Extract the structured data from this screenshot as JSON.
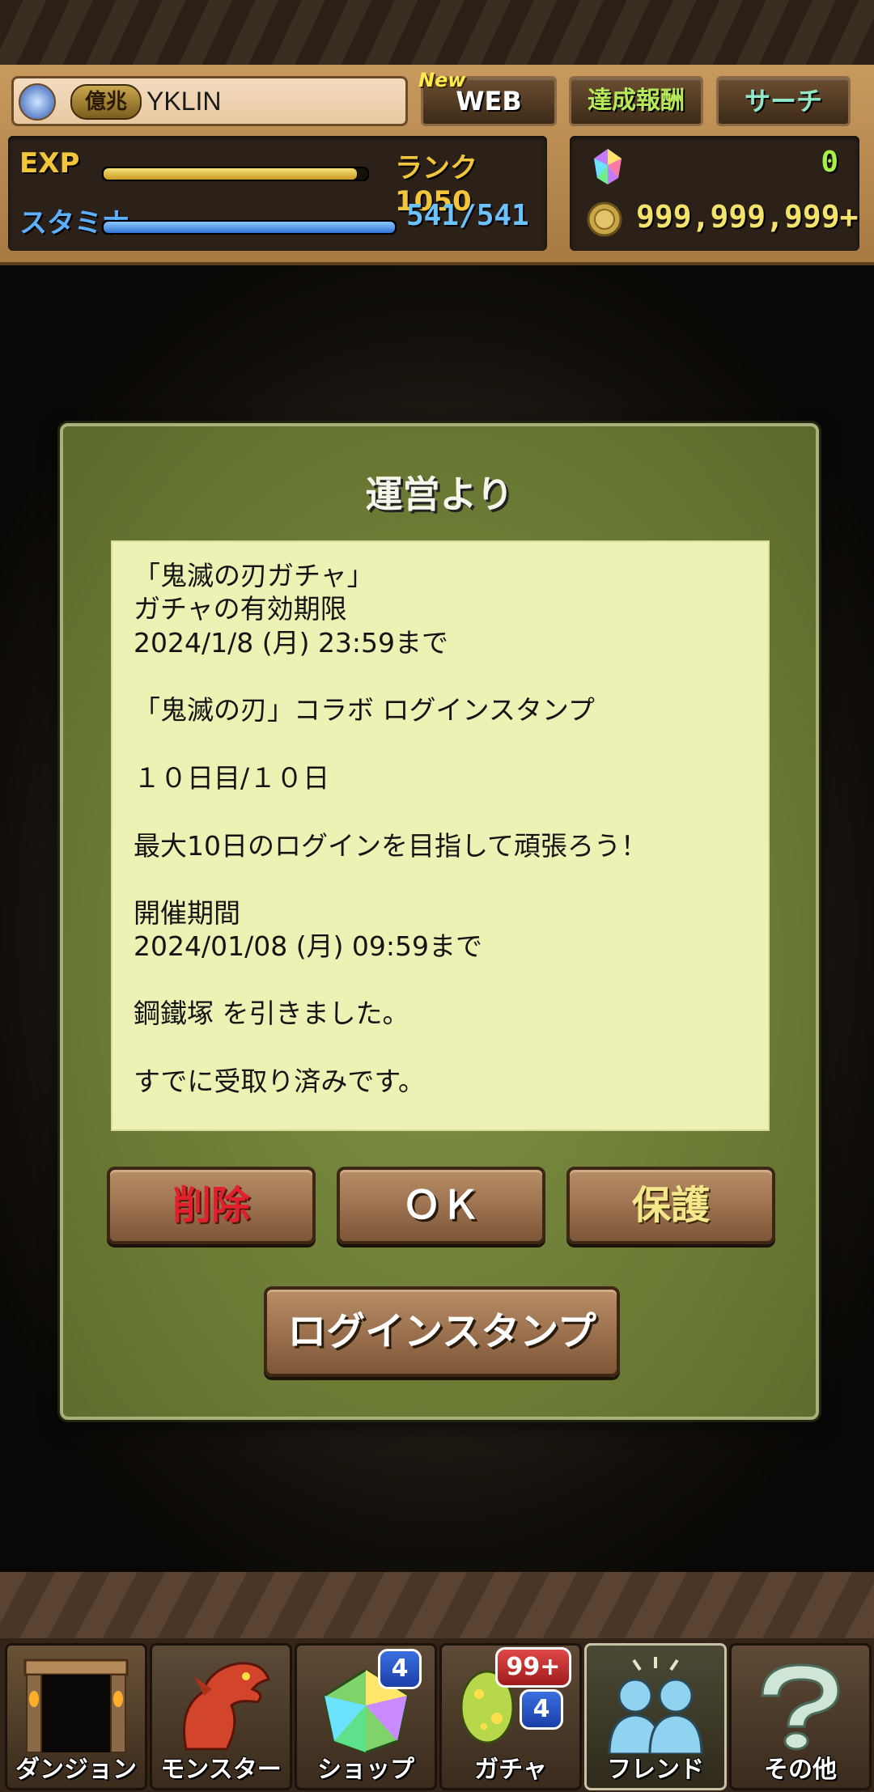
{
  "header": {
    "badge": "億兆",
    "player_name": "YKLIN",
    "new_tag": "New",
    "web_button": "WEB",
    "achievements_button": "達成報酬",
    "search_button": "サーチ",
    "exp_label": "EXP",
    "rank_text": "ランク1050",
    "exp_progress": 0.96,
    "stamina_label": "スタミナ",
    "stamina_value": "541/541",
    "stamina_progress": 1.0,
    "magic_stones": "0",
    "coins": "999,999,999+"
  },
  "dialog": {
    "title": "運営より",
    "message_lines": [
      "「鬼滅の刃ガチャ」",
      "ガチャの有効期限",
      "2024/1/8 (月) 23:59まで",
      "",
      "「鬼滅の刃」コラボ ログインスタンプ",
      "",
      "１０日目/１０日",
      "",
      "最大10日のログインを目指して頑張ろう！",
      "",
      "開催期間",
      "2024/01/08 (月) 09:59まで",
      "",
      "鋼鐵塚 を引きました。",
      "",
      "すでに受取り済みです。"
    ],
    "delete_button": "削除",
    "ok_button": "ＯＫ",
    "protect_button": "保護",
    "login_stamp_button": "ログインスタンプ"
  },
  "nav": {
    "items": [
      {
        "label": "ダンジョン",
        "icon": "dungeon-gate-icon"
      },
      {
        "label": "モンスター",
        "icon": "red-dragon-icon"
      },
      {
        "label": "ショップ",
        "icon": "rainbow-gem-icon",
        "badge": "4"
      },
      {
        "label": "ガチャ",
        "icon": "egg-icon",
        "badge_top": "99+",
        "badge": "4"
      },
      {
        "label": "フレンド",
        "icon": "friends-icon"
      },
      {
        "label": "その他",
        "icon": "question-mark-icon"
      }
    ]
  },
  "colors": {
    "exp_bar": "#e8c34a",
    "stamina_bar": "#3a8be0",
    "dialog_bg": "#6c7c35",
    "message_bg": "#edf2b4",
    "delete_text": "#e0202a",
    "protect_text": "#f4e88a"
  }
}
